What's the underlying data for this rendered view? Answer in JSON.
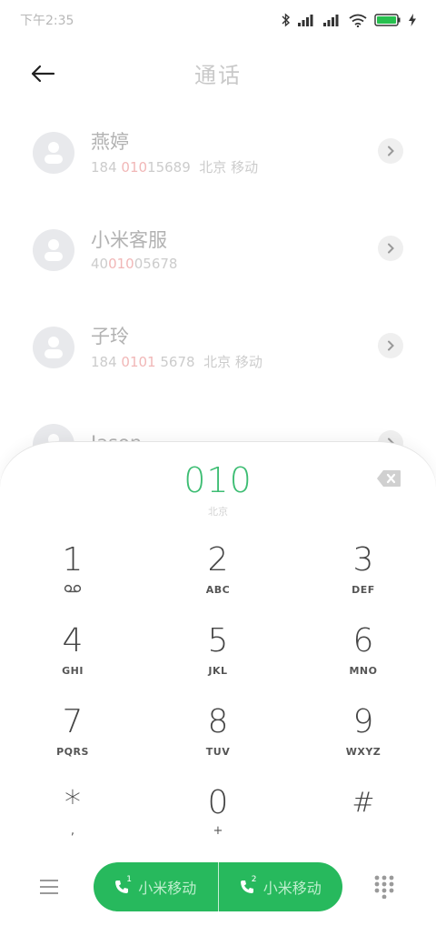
{
  "status": {
    "time": "下午2:35"
  },
  "header": {
    "title": "通话"
  },
  "contacts": [
    {
      "name": "燕婷",
      "sub_pre": "184 ",
      "sub_hl": "010",
      "sub_post": "15689  北京 移动"
    },
    {
      "name": "小米客服",
      "sub_pre": "40",
      "sub_hl": "010",
      "sub_post": "05678"
    },
    {
      "name": "子玲",
      "sub_pre": "184 ",
      "sub_hl": "0101",
      "sub_post": " 5678  北京 移动"
    },
    {
      "name": "Jason",
      "sub_pre": "",
      "sub_hl": "",
      "sub_post": ""
    }
  ],
  "dialer": {
    "number": "010",
    "location": "北京",
    "keys": [
      {
        "digit": "1",
        "letters": ""
      },
      {
        "digit": "2",
        "letters": "ABC"
      },
      {
        "digit": "3",
        "letters": "DEF"
      },
      {
        "digit": "4",
        "letters": "GHI"
      },
      {
        "digit": "5",
        "letters": "JKL"
      },
      {
        "digit": "6",
        "letters": "MNO"
      },
      {
        "digit": "7",
        "letters": "PQRS"
      },
      {
        "digit": "8",
        "letters": "TUV"
      },
      {
        "digit": "9",
        "letters": "WXYZ"
      },
      {
        "digit": "*",
        "letters": ","
      },
      {
        "digit": "0",
        "letters": "+"
      },
      {
        "digit": "#",
        "letters": ""
      }
    ]
  },
  "calls": {
    "sim1": {
      "num": "1",
      "label": "小米移动"
    },
    "sim2": {
      "num": "2",
      "label": "小米移动"
    }
  },
  "colors": {
    "accent": "#27b95d",
    "number": "#3dbd73",
    "highlight": "#f1b7b7"
  }
}
